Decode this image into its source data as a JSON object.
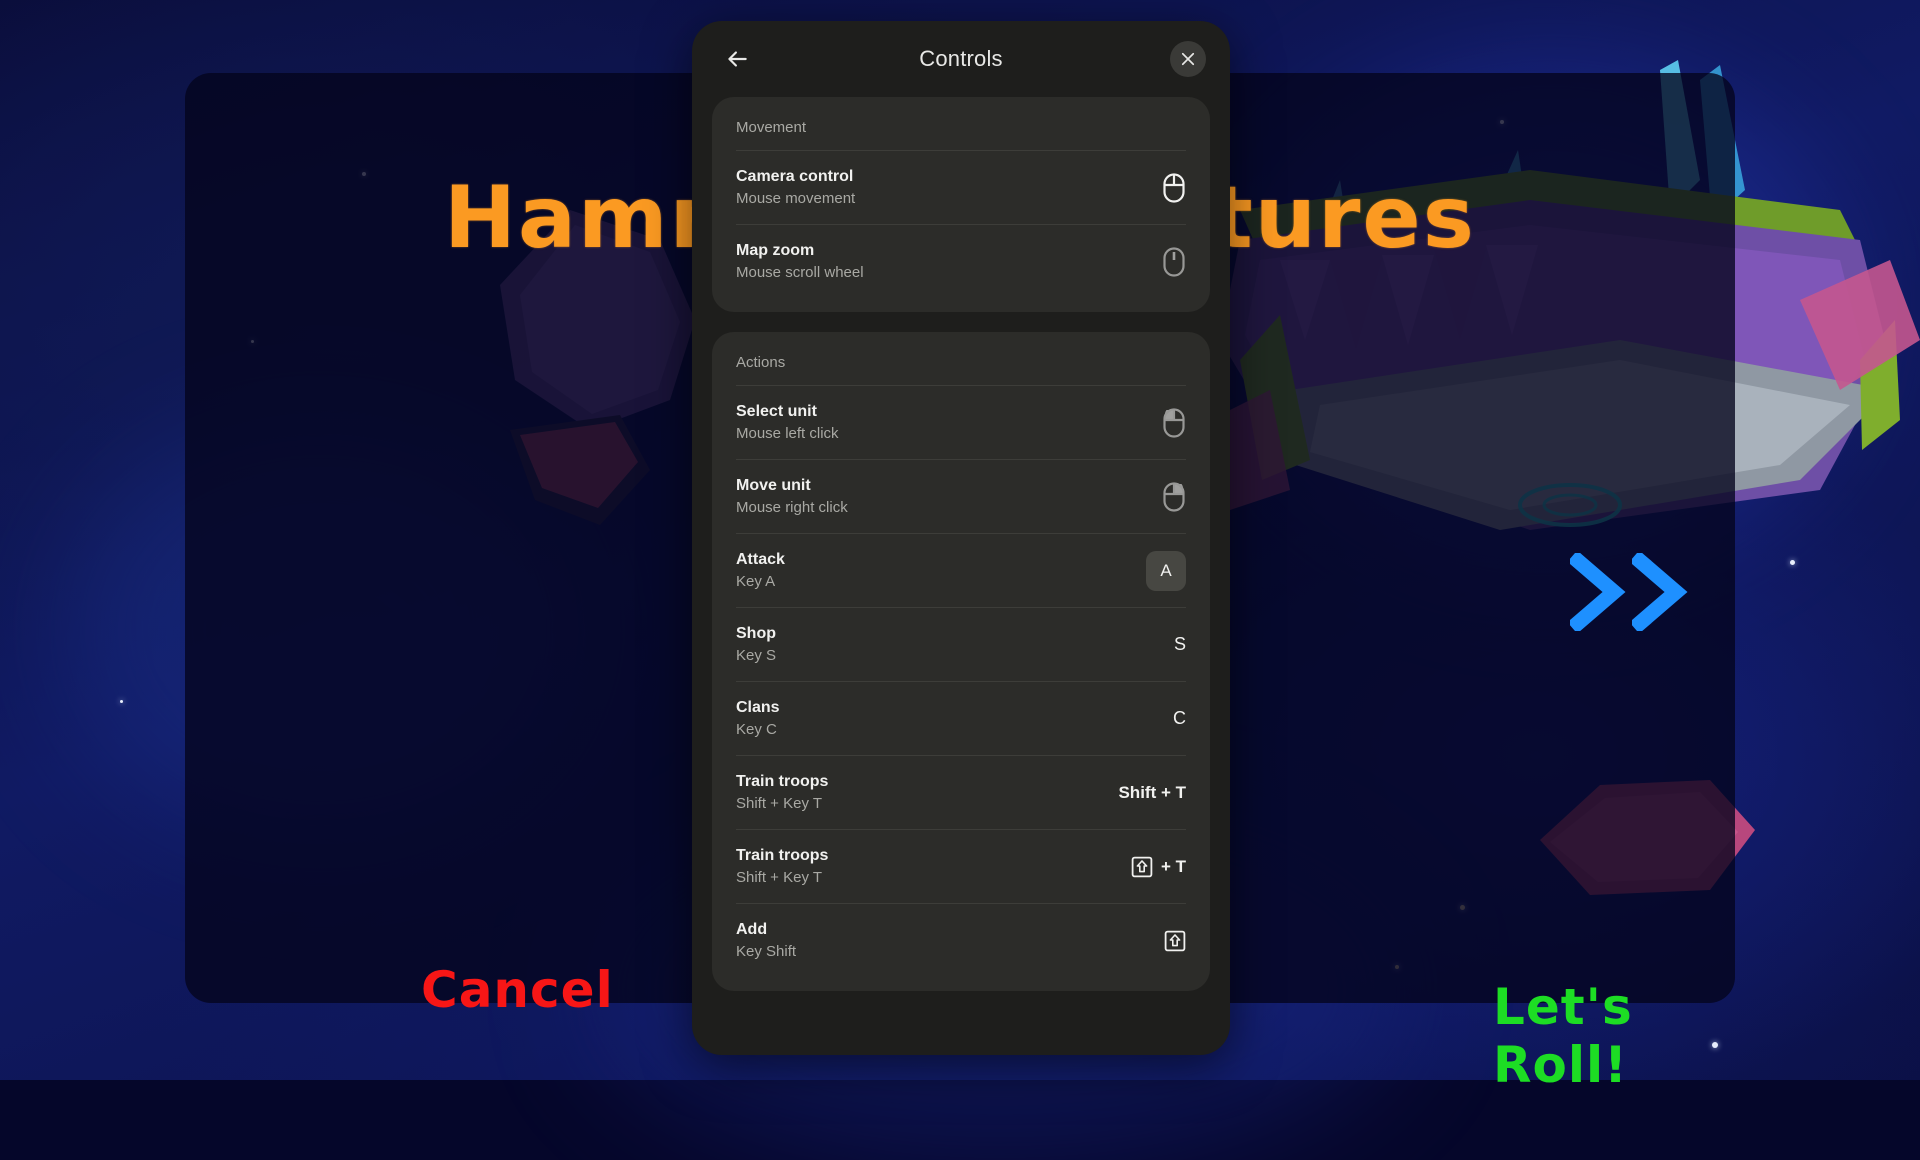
{
  "game": {
    "title": "Hammer Adventures",
    "cancel_label": "Cancel",
    "confirm_label": "Let's Roll!",
    "chevron_icon": "double-chevron-right-icon",
    "colors": {
      "title": "#fb9a22",
      "cancel": "#f71616",
      "confirm": "#1ddd24",
      "chevron": "#1e90ff",
      "space_bg": "#0b1046"
    }
  },
  "dialog": {
    "title": "Controls",
    "back_icon": "arrow-left-icon",
    "close_icon": "close-icon",
    "sections": [
      {
        "title": "Movement",
        "rows": [
          {
            "label": "Camera control",
            "sub": "Mouse movement",
            "binding_type": "mouse",
            "icon": "mouse-icon",
            "icon_state": "body",
            "key_text": ""
          },
          {
            "label": "Map zoom",
            "sub": "Mouse scroll wheel",
            "binding_type": "mouse",
            "icon": "mouse-scroll-wheel-icon",
            "icon_state": "wheel",
            "key_text": ""
          }
        ]
      },
      {
        "title": "Actions",
        "rows": [
          {
            "label": "Select unit",
            "sub": "Mouse left click",
            "binding_type": "mouse",
            "icon": "mouse-left-click-icon",
            "icon_state": "left",
            "key_text": ""
          },
          {
            "label": "Move unit",
            "sub": "Mouse right click",
            "binding_type": "mouse",
            "icon": "mouse-right-click-icon",
            "icon_state": "right",
            "key_text": ""
          },
          {
            "label": "Attack",
            "sub": "Key A",
            "binding_type": "key-badge",
            "icon": "",
            "icon_state": "",
            "key_text": "A"
          },
          {
            "label": "Shop",
            "sub": "Key S",
            "binding_type": "key-plain",
            "icon": "",
            "icon_state": "",
            "key_text": "S"
          },
          {
            "label": "Clans",
            "sub": "Key C",
            "binding_type": "key-plain",
            "icon": "",
            "icon_state": "",
            "key_text": "C"
          },
          {
            "label": "Train troops",
            "sub": "Shift + Key T",
            "binding_type": "key-combo-text",
            "icon": "",
            "icon_state": "",
            "key_text": "Shift + T"
          },
          {
            "label": "Train troops",
            "sub": "Shift + Key T",
            "binding_type": "shift-icon-plus-key",
            "icon": "shift-key-icon",
            "icon_state": "",
            "key_text": "+ T"
          },
          {
            "label": "Add",
            "sub": "Key Shift",
            "binding_type": "shift-icon",
            "icon": "shift-key-icon",
            "icon_state": "",
            "key_text": ""
          }
        ]
      }
    ]
  }
}
